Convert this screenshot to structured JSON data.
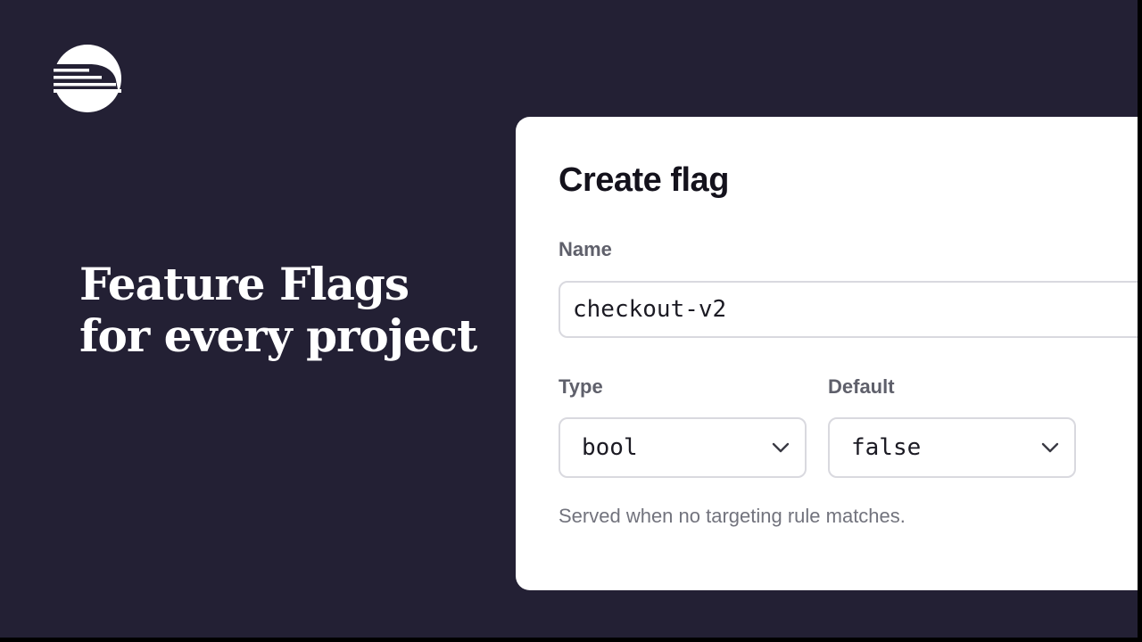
{
  "hero": {
    "logo_icon": "train-icon",
    "headline_line1": "Feature Flags",
    "headline_line2": "for every project"
  },
  "dialog": {
    "title": "Create flag",
    "name": {
      "label": "Name",
      "value": "checkout-v2"
    },
    "type": {
      "label": "Type",
      "value": "bool",
      "icon": "chevron-down-icon"
    },
    "default": {
      "label": "Default",
      "value": "false",
      "icon": "chevron-down-icon"
    },
    "helper_text": "Served when no targeting rule matches."
  },
  "colors": {
    "background": "#232034",
    "card": "#ffffff",
    "headline": "#ffffff",
    "field_border": "#d9d9df",
    "label": "#5f606b",
    "helper": "#72737d"
  }
}
